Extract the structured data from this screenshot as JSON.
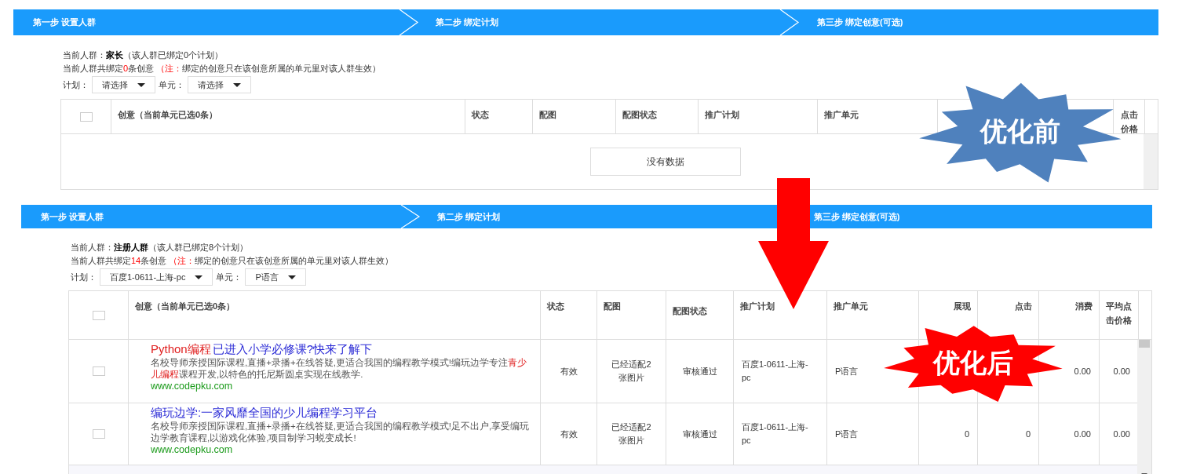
{
  "panels": [
    {
      "steps": [
        "第一步 设置人群",
        "第二步 绑定计划",
        "第三步 绑定创意(可选)"
      ],
      "audience_label": "当前人群：",
      "audience": "家长",
      "audience_note": "（该人群已绑定0个计划）",
      "bound_prefix": "当前人群共绑定",
      "bound_count": "0",
      "bound_suffix": "条创意",
      "note_label": "（注：",
      "note_text": "绑定的创意只在该创意所属的单元里对该人群生效）",
      "plan_label": "计划：",
      "plan_value": "请选择",
      "unit_label": "单元：",
      "unit_value": "请选择",
      "select_all_checked": false,
      "columns": [
        "创意（当前单元已选0条）",
        "状态",
        "配图",
        "配图状态",
        "推广计划",
        "推广单元",
        "点击价格"
      ],
      "empty_text": "没有数据"
    },
    {
      "steps": [
        "第一步 设置人群",
        "第二步 绑定计划",
        "第三步 绑定创意(可选)"
      ],
      "audience_label": "当前人群：",
      "audience": "注册人群",
      "audience_note": "（该人群已绑定8个计划）",
      "bound_prefix": "当前人群共绑定",
      "bound_count": "14",
      "bound_suffix": "条创意",
      "note_label": "（注：",
      "note_text": "绑定的创意只在该创意所属的单元里对该人群生效）",
      "plan_label": "计划：",
      "plan_value": "百度1-0611-上海-pc",
      "unit_label": "单元：",
      "unit_value": "P语言",
      "select_all_checked": false,
      "columns": [
        "创意（当前单元已选0条）",
        "状态",
        "配图",
        "配图状态",
        "推广计划",
        "推广单元",
        "展现",
        "点击",
        "消费",
        "平均点击价格"
      ],
      "rows": [
        {
          "checked": false,
          "title": [
            {
              "text": "Python编程",
              "highlight": true
            },
            {
              "text": "已进入小学必修课?快来了解下",
              "highlight": false
            }
          ],
          "desc": [
            {
              "text": "名校导师亲授国际课程,直播+录播+在线答疑,更适合我国的编程教学模式!编玩边学专注",
              "highlight": false
            },
            {
              "text": "青少儿编程",
              "highlight": true
            },
            {
              "text": "课程开发,以特色的托尼斯圆桌实现在线教学.",
              "highlight": false
            }
          ],
          "url": "www.codepku.com",
          "status": "有效",
          "image": "已经适配2张图片",
          "image_status": "审核通过",
          "plan": "百度1-0611-上海-pc",
          "unit": "P语言",
          "cost": "0.00",
          "avg_cpc": "0.00"
        },
        {
          "checked": false,
          "title": [
            {
              "text": "编玩边学:一家风靡全国的少儿编程学习平台",
              "highlight": false
            }
          ],
          "desc": [
            {
              "text": "名校导师亲授国际课程,直播+录播+在线答疑,更适合我国的编程教学模式!足不出户,享受编玩边学教育课程,以游戏化体验,项目制学习蜕变成长!",
              "highlight": false
            }
          ],
          "url": "www.codepku.com",
          "status": "有效",
          "image": "已经适配2张图片",
          "image_status": "审核通过",
          "plan": "百度1-0611-上海-pc",
          "unit": "P语言",
          "impressions": "0",
          "clicks": "0",
          "cost": "0.00",
          "avg_cpc": "0.00"
        }
      ]
    }
  ],
  "annotations": [
    {
      "kind": "burst",
      "text": "优化前",
      "color": "#4f81bd"
    },
    {
      "kind": "arrow",
      "color": "#ff0000"
    },
    {
      "kind": "burst",
      "text": "优化后",
      "color": "#ff0000"
    }
  ]
}
